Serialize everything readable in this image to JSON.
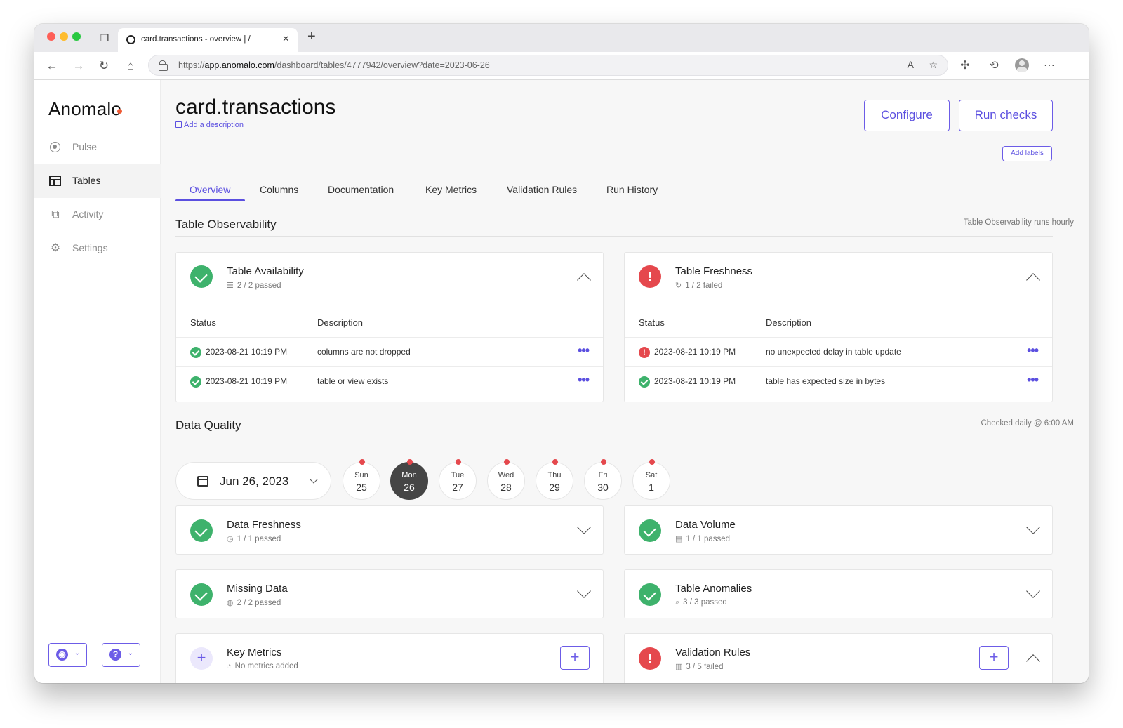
{
  "browser": {
    "tab_title": "card.transactions - overview | /",
    "url_prefix": "https://",
    "url_host": "app.anomalo.com",
    "url_path": "/dashboard/tables/4777942/overview?date=2023-06-26"
  },
  "sidebar": {
    "logo": "Anomalo",
    "items": [
      {
        "label": "Pulse",
        "icon": "pulse-icon"
      },
      {
        "label": "Tables",
        "icon": "table-icon"
      },
      {
        "label": "Activity",
        "icon": "activity-icon"
      },
      {
        "label": "Settings",
        "icon": "gear-icon"
      }
    ]
  },
  "header": {
    "title": "card.transactions",
    "add_description": "Add a description",
    "configure_label": "Configure",
    "run_checks_label": "Run checks",
    "add_labels_label": "Add labels"
  },
  "tabs": [
    "Overview",
    "Columns",
    "Documentation",
    "Key Metrics",
    "Validation Rules",
    "Run History"
  ],
  "observability": {
    "title": "Table Observability",
    "note": "Table Observability runs hourly",
    "status_header": "Status",
    "description_header": "Description",
    "availability": {
      "title": "Table Availability",
      "summary": "2 / 2 passed",
      "rows": [
        {
          "status": "pass",
          "time": "2023-08-21 10:19 PM",
          "description": "columns are not dropped"
        },
        {
          "status": "pass",
          "time": "2023-08-21 10:19 PM",
          "description": "table or view exists"
        }
      ]
    },
    "freshness": {
      "title": "Table Freshness",
      "summary": "1 / 2 failed",
      "rows": [
        {
          "status": "fail",
          "time": "2023-08-21 10:19 PM",
          "description": "no unexpected delay in table update"
        },
        {
          "status": "pass",
          "time": "2023-08-21 10:19 PM",
          "description": "table has expected size in bytes"
        }
      ]
    }
  },
  "data_quality": {
    "title": "Data Quality",
    "note": "Checked daily @ 6:00 AM",
    "selected_date": "Jun 26, 2023",
    "days": [
      {
        "name": "Sun",
        "num": "25"
      },
      {
        "name": "Mon",
        "num": "26"
      },
      {
        "name": "Tue",
        "num": "27"
      },
      {
        "name": "Wed",
        "num": "28"
      },
      {
        "name": "Thu",
        "num": "29"
      },
      {
        "name": "Fri",
        "num": "30"
      },
      {
        "name": "Sat",
        "num": "1"
      }
    ],
    "cards": {
      "data_freshness": {
        "title": "Data Freshness",
        "summary": "1 / 1 passed"
      },
      "data_volume": {
        "title": "Data Volume",
        "summary": "1 / 1 passed"
      },
      "missing_data": {
        "title": "Missing Data",
        "summary": "2 / 2 passed"
      },
      "table_anomalies": {
        "title": "Table Anomalies",
        "summary": "3 / 3 passed"
      },
      "key_metrics": {
        "title": "Key Metrics",
        "summary": "No metrics added"
      },
      "validation_rules": {
        "title": "Validation Rules",
        "summary": "3 / 5 failed"
      }
    }
  },
  "colors": {
    "accent": "#5b4fe0",
    "pass": "#3eb26c",
    "fail": "#e5484d"
  }
}
